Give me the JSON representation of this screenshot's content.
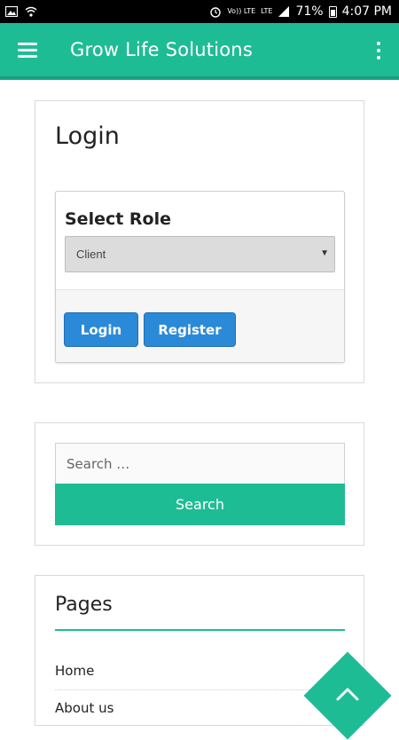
{
  "status_bar": {
    "battery_level": "71%",
    "time": "4:07 PM",
    "lte_top": "Vo)) LTE",
    "lte_second": "LTE"
  },
  "app_bar": {
    "title": "Grow Life Solutions",
    "color": "#1ebc94"
  },
  "login": {
    "title": "Login",
    "role_label": "Select Role",
    "role_selected": "Client",
    "login_button": "Login",
    "register_button": "Register",
    "button_color": "#2b8ad8"
  },
  "search": {
    "placeholder": "Search …",
    "button_label": "Search"
  },
  "pages": {
    "title": "Pages",
    "items": [
      "Home",
      "About us"
    ]
  }
}
